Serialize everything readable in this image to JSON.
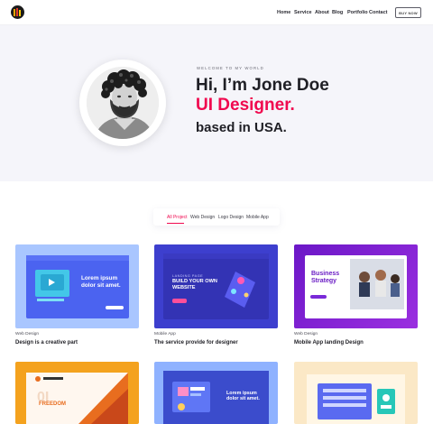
{
  "nav": {
    "items": [
      "Home",
      "Service",
      "About",
      "Blog",
      "Portfolio",
      "Contact"
    ],
    "buy_label": "BUY NOW"
  },
  "hero": {
    "welcome": "WELCOME TO MY WORLD",
    "line1": "Hi, I’m Jone Doe",
    "line2": "UI Designer.",
    "line3": "based in USA."
  },
  "tabs": [
    "All Project",
    "Web Design",
    "Logo Design",
    "Mobile App"
  ],
  "cards": [
    {
      "category": "Web Design",
      "title": "Design is a creative part",
      "thumb_text": "Lorem ipsum dolor sit amet."
    },
    {
      "category": "Mobile App",
      "title": "The service provide for designer",
      "thumb_kicker": "LANDING PAGE",
      "thumb_text": "BUILD YOUR OWN WEBSITE"
    },
    {
      "category": "Web Design",
      "title": "Mobile App landing Design",
      "thumb_text": "Business Strategy"
    },
    {
      "category": "",
      "title": "",
      "thumb_text": "FREEDOM"
    },
    {
      "category": "",
      "title": "",
      "thumb_text": "Lorem ipsum dolor sit amet."
    },
    {
      "category": "",
      "title": "",
      "thumb_text": ""
    }
  ],
  "colors": {
    "accent": "#f0094f",
    "hero_bg": "#f5f5fa",
    "heading": "#1f1f25"
  }
}
